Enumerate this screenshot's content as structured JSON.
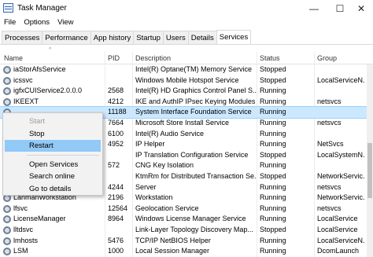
{
  "window": {
    "title": "Task Manager",
    "minimize_glyph": "—",
    "maximize_glyph": "☐",
    "close_glyph": "✕"
  },
  "menu": [
    "File",
    "Options",
    "View"
  ],
  "tabs": [
    {
      "label": "Processes",
      "active": false
    },
    {
      "label": "Performance",
      "active": false
    },
    {
      "label": "App history",
      "active": false
    },
    {
      "label": "Startup",
      "active": false
    },
    {
      "label": "Users",
      "active": false
    },
    {
      "label": "Details",
      "active": false
    },
    {
      "label": "Services",
      "active": true
    }
  ],
  "columns": {
    "name": "Name",
    "pid": "PID",
    "description": "Description",
    "status": "Status",
    "group": "Group",
    "sort_glyph": "^"
  },
  "rows": [
    {
      "name": "iaStorAfsService",
      "pid": "",
      "description": "Intel(R) Optane(TM) Memory Service",
      "status": "Stopped",
      "group": "",
      "selected": false
    },
    {
      "name": "icssvc",
      "pid": "",
      "description": "Windows Mobile Hotspot Service",
      "status": "Stopped",
      "group": "LocalServiceN...",
      "selected": false
    },
    {
      "name": "igfxCUIService2.0.0.0",
      "pid": "2568",
      "description": "Intel(R) HD Graphics Control Panel S...",
      "status": "Running",
      "group": "",
      "selected": false
    },
    {
      "name": "IKEEXT",
      "pid": "4212",
      "description": "IKE and AuthIP IPsec Keying Modules",
      "status": "Running",
      "group": "netsvcs",
      "selected": false
    },
    {
      "name": "",
      "pid": "11188",
      "description": "System Interface Foundation Service",
      "status": "Running",
      "group": "",
      "selected": true
    },
    {
      "name": "",
      "pid": "7664",
      "description": "Microsoft Store Install Service",
      "status": "Running",
      "group": "netsvcs",
      "selected": false
    },
    {
      "name": "",
      "pid": "6100",
      "description": "Intel(R) Audio Service",
      "status": "Running",
      "group": "",
      "selected": false
    },
    {
      "name": "",
      "pid": "4952",
      "description": "IP Helper",
      "status": "Running",
      "group": "NetSvcs",
      "selected": false
    },
    {
      "name": "",
      "pid": "",
      "description": "IP Translation Configuration Service",
      "status": "Stopped",
      "group": "LocalSystemN...",
      "selected": false
    },
    {
      "name": "",
      "pid": "572",
      "description": "CNG Key Isolation",
      "status": "Running",
      "group": "",
      "selected": false
    },
    {
      "name": "",
      "pid": "",
      "description": "KtmRm for Distributed Transaction Se...",
      "status": "Stopped",
      "group": "NetworkServic...",
      "selected": false
    },
    {
      "name": "",
      "pid": "4244",
      "description": "Server",
      "status": "Running",
      "group": "netsvcs",
      "selected": false
    },
    {
      "name": "LanmanWorkstation",
      "pid": "2196",
      "description": "Workstation",
      "status": "Running",
      "group": "NetworkServic...",
      "selected": false
    },
    {
      "name": "lfsvc",
      "pid": "12564",
      "description": "Geolocation Service",
      "status": "Running",
      "group": "netsvcs",
      "selected": false
    },
    {
      "name": "LicenseManager",
      "pid": "8964",
      "description": "Windows License Manager Service",
      "status": "Running",
      "group": "LocalService",
      "selected": false
    },
    {
      "name": "lltdsvc",
      "pid": "",
      "description": "Link-Layer Topology Discovery Map...",
      "status": "Stopped",
      "group": "LocalService",
      "selected": false
    },
    {
      "name": "lmhosts",
      "pid": "5476",
      "description": "TCP/IP NetBIOS Helper",
      "status": "Running",
      "group": "LocalServiceN...",
      "selected": false
    },
    {
      "name": "LSM",
      "pid": "1000",
      "description": "Local Session Manager",
      "status": "Running",
      "group": "DcomLaunch",
      "selected": false
    }
  ],
  "context_menu": [
    {
      "label": "Start",
      "disabled": true,
      "hover": false,
      "sep_before": false
    },
    {
      "label": "Stop",
      "disabled": false,
      "hover": false,
      "sep_before": false
    },
    {
      "label": "Restart",
      "disabled": false,
      "hover": true,
      "sep_before": false
    },
    {
      "label": "Open Services",
      "disabled": false,
      "hover": false,
      "sep_before": true
    },
    {
      "label": "Search online",
      "disabled": false,
      "hover": false,
      "sep_before": false
    },
    {
      "label": "Go to details",
      "disabled": false,
      "hover": false,
      "sep_before": false
    }
  ],
  "icons": {
    "app": "task-manager-icon",
    "service": "gear-icon"
  },
  "colors": {
    "selected_row": "#cce8ff",
    "menu_hover": "#91c9f7"
  }
}
